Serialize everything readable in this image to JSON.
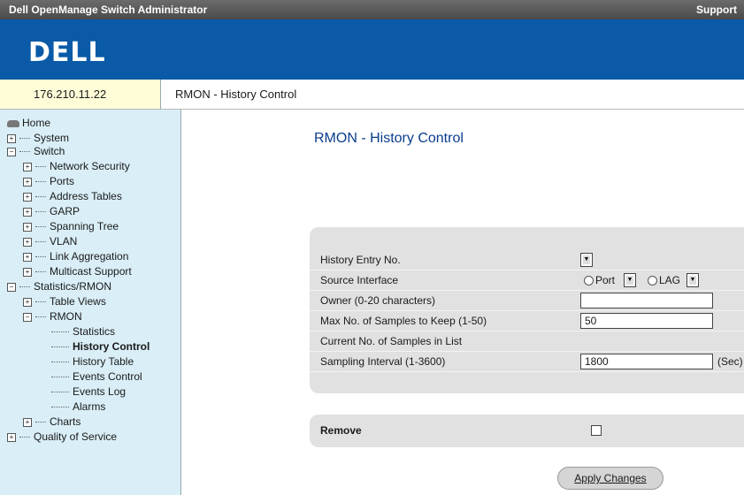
{
  "app": {
    "title": "Dell OpenManage Switch Administrator",
    "support_label": "Support",
    "logo_text": "DELL"
  },
  "device": {
    "ip": "176.210.11.22"
  },
  "breadcrumb": "RMON - History Control",
  "tree": {
    "home": "Home",
    "system": "System",
    "switch": "Switch",
    "network_security": "Network Security",
    "ports": "Ports",
    "address_tables": "Address Tables",
    "garp": "GARP",
    "spanning_tree": "Spanning Tree",
    "vlan": "VLAN",
    "link_aggregation": "Link Aggregation",
    "multicast_support": "Multicast Support",
    "statistics_rmon": "Statistics/RMON",
    "table_views": "Table Views",
    "rmon": "RMON",
    "statistics": "Statistics",
    "history_control": "History Control",
    "history_table": "History Table",
    "events_control": "Events Control",
    "events_log": "Events Log",
    "alarms": "Alarms",
    "charts": "Charts",
    "qos": "Quality of Service"
  },
  "page_title": "RMON - History Control",
  "form": {
    "history_entry_label": "History Entry No.",
    "source_interface_label": "Source Interface",
    "port_label": "Port",
    "lag_label": "LAG",
    "owner_label": "Owner (0-20 characters)",
    "max_samples_label": "Max No. of Samples to Keep (1-50)",
    "max_samples_value": "50",
    "current_samples_label": "Current No. of Samples in List",
    "sampling_interval_label": "Sampling Interval (1-3600)",
    "sampling_interval_value": "1800",
    "sampling_unit": "(Sec)"
  },
  "remove_label": "Remove",
  "apply_button": "Apply Changes",
  "colors": {
    "brand_blue": "#0a5aa7",
    "tree_bg": "#d9eef7",
    "panel_bg": "#e1e1e1"
  }
}
